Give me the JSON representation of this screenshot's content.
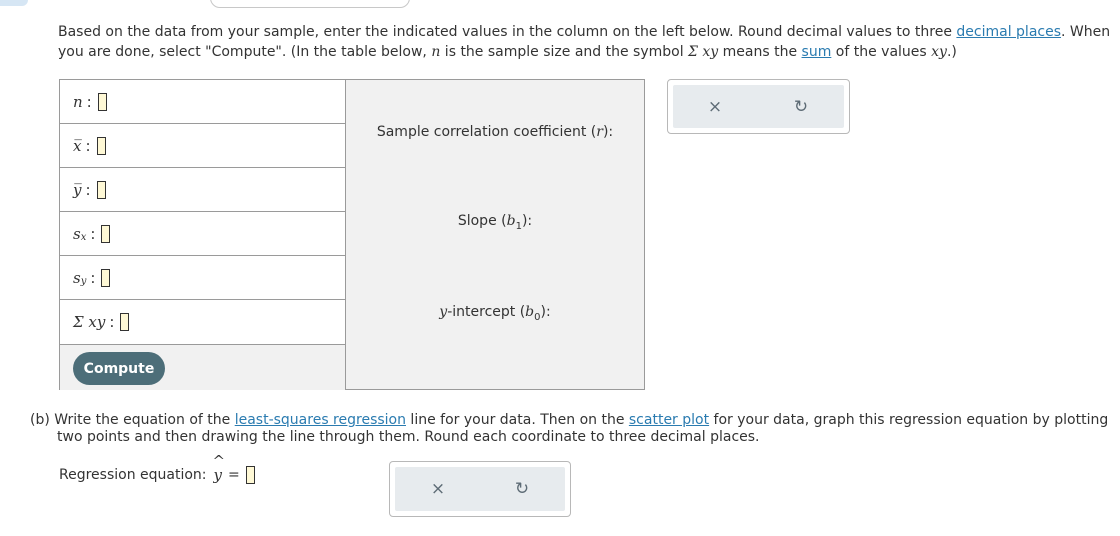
{
  "instructions": {
    "text_1": "Based on the data from your sample, enter the indicated values in the column on the left below. Round decimal values to three ",
    "link_decimal": "decimal places",
    "text_2": ". When you are done, select \"Compute\". (In the table below, ",
    "n_symbol": "n",
    "text_3": " is the sample size and the symbol ",
    "sigma_xy": "Σ xy",
    "text_4": " means the ",
    "link_sum": "sum",
    "text_5": " of the values ",
    "xy_symbol": "xy",
    "text_6": ".)"
  },
  "table": {
    "rows": [
      {
        "label": "n"
      },
      {
        "label": "x̅"
      },
      {
        "label": "y̅"
      },
      {
        "label": "s",
        "sub": "x"
      },
      {
        "label": "s",
        "sub": "y"
      },
      {
        "label": "Σ xy"
      }
    ],
    "colon": ":",
    "compute_label": "Compute"
  },
  "results": {
    "corr_label": "Sample correlation coefficient (",
    "corr_sym": "r",
    "corr_end": "):",
    "slope_label": "Slope (",
    "slope_sym": "b",
    "slope_sub": "1",
    "slope_end": "):",
    "intercept_pre": "y",
    "intercept_label": "-intercept (",
    "intercept_sym": "b",
    "intercept_sub": "0",
    "intercept_end": "):"
  },
  "actions": {
    "clear_icon": "×",
    "undo_icon": "↻"
  },
  "part_b": {
    "prefix": "(b)",
    "text_1": "Write the equation of the ",
    "link_lsr": "least-squares regression",
    "text_2": " line for your data. Then on the ",
    "link_scatter": "scatter plot",
    "text_3": " for your data, graph this regression equation by plotting",
    "text_4": "two points and then drawing the line through them. Round each coordinate to three decimal places.",
    "reg_label": "Regression equation:",
    "yhat": "y",
    "hat": "^",
    "equals": "="
  },
  "colors": {
    "link": "#2a7bb0",
    "compute_button": "#4d6e79",
    "input_fill": "#fff9d6",
    "panel_bg": "#f1f1f1"
  }
}
